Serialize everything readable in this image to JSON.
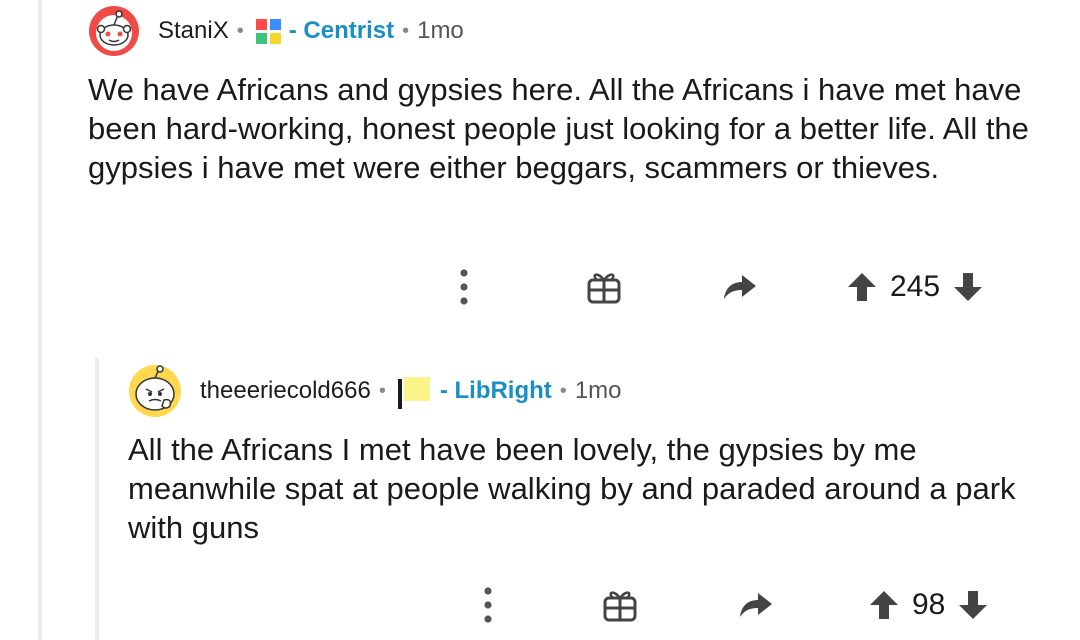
{
  "colors": {
    "thread_line": "#ededed",
    "centrist_flair": "#1a8fc6",
    "libright_flair": "#1a8fc6",
    "libright_square": "#f9f38a",
    "quad_auth_left": "#ff4b4b",
    "quad_auth_right": "#3b8cff",
    "quad_lib_left": "#3cc47c",
    "quad_lib_right": "#f5d62e"
  },
  "comments": [
    {
      "username": "StaniX",
      "separator": "•",
      "flair_icon": "political-compass-quad-icon",
      "leaning": "- Centrist",
      "time": "1mo",
      "text": "We have Africans and gypsies here. All the Africans i have met have been hard-working, honest people just looking for a better life. All the gypsies i have met were either beggars, scammers or thieves.",
      "score": "245"
    },
    {
      "username": "theeeriecold666",
      "separator": "•",
      "flair_icon": "libright-square-icon",
      "leaning": "- LibRight",
      "time": "1mo",
      "text": "All the Africans I met have been lovely, the gypsies by me meanwhile spat at people walking by and paraded around a park with guns",
      "score": "98"
    }
  ]
}
